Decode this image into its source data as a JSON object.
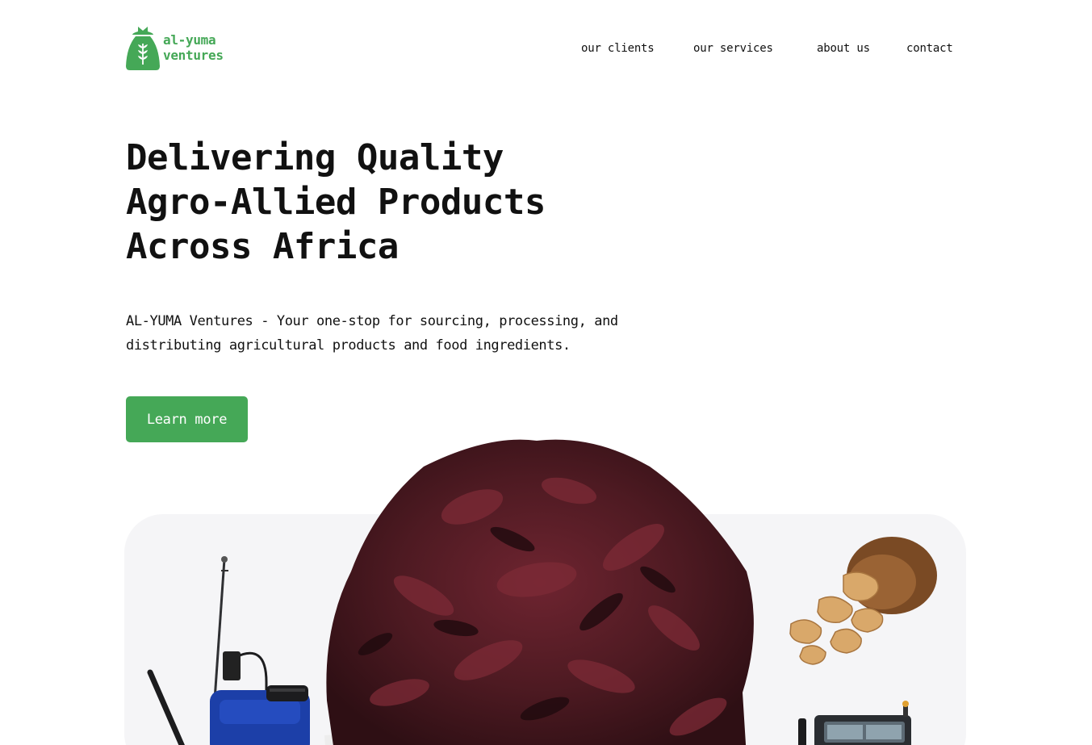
{
  "brand": {
    "line1": "al-yuma",
    "line2": "ventures",
    "color": "#45a857",
    "icon": "grain-sack-icon"
  },
  "nav": {
    "items": [
      {
        "label": "our clients"
      },
      {
        "label": "our services"
      },
      {
        "label": "about us"
      },
      {
        "label": "contact"
      }
    ]
  },
  "hero": {
    "title_lines": [
      "Delivering Quality",
      "Agro-Allied Products",
      "Across Africa"
    ],
    "subtitle": "AL-YUMA Ventures - Your one-stop for sourcing, processing, and distributing agricultural products and food ingredients.",
    "cta_label": "Learn more",
    "cta_color": "#45a857"
  },
  "showcase": {
    "background": "#f5f5f7",
    "images": [
      {
        "name": "knapsack-sprayer-image"
      },
      {
        "name": "dried-hibiscus-image"
      },
      {
        "name": "dried-ginger-bowl-image"
      },
      {
        "name": "tractor-image"
      }
    ]
  }
}
